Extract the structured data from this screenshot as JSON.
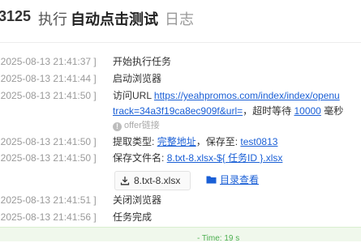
{
  "header": {
    "task_id": "3125",
    "exec_label": "执行",
    "task_name": "自动点击测试",
    "log_label": "日志"
  },
  "logs": [
    {
      "timestamp": "[ 2025-08-13 21:41:37 ]",
      "message": "开始执行任务"
    },
    {
      "timestamp": "[ 2025-08-13 21:41:44 ]",
      "message": "启动浏览器"
    },
    {
      "timestamp": "[ 2025-08-13 21:41:50 ]",
      "visit_label": "访问URL",
      "url_line1": "https://yeahpromos.com/index/index/openu",
      "url_line2": "track=34a3f19ca8ec909f&url=",
      "timeout_label": "，超时等待",
      "timeout_value": "10000",
      "timeout_unit": "毫秒",
      "offer_note": "offer链接"
    },
    {
      "timestamp": "[ 2025-08-13 21:41:50 ]",
      "extract_label": "提取类型:",
      "extract_value": "完整地址",
      "save_label": "，保存至:",
      "save_value": "test0813"
    },
    {
      "timestamp": "[ 2025-08-13 21:41:50 ]",
      "filename_label": "保存文件名:",
      "filename_value": "8.txt-8.xlsx-${ 任务ID }.xlsx",
      "file_chip": "8.txt-8.xlsx",
      "dir_button": "目录查看"
    },
    {
      "timestamp": "[ 2025-08-13 21:41:51 ]",
      "message": "关闭浏览器"
    },
    {
      "timestamp": "[ 2025-08-13 21:41:56 ]",
      "message": "任务完成"
    }
  ],
  "footer": {
    "time_text": "- Time: 19 s"
  },
  "colors": {
    "link": "#1a5fd6",
    "timestamp": "#9a9a9a",
    "success": "#4caf50"
  }
}
